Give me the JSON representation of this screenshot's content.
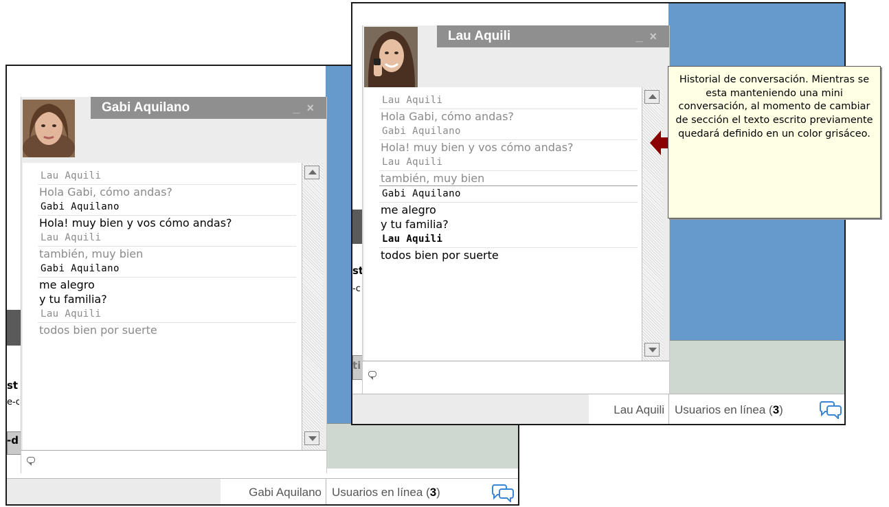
{
  "back_window": {
    "title": "Gabi Aquilano",
    "controls": {
      "minimize": "_",
      "close": "×"
    },
    "messages": [
      {
        "kind": "sender",
        "text": "Lau Aquili",
        "tone": "grey"
      },
      {
        "kind": "text",
        "text": "Hola Gabi, cómo andas?",
        "tone": "grey"
      },
      {
        "kind": "sender",
        "text": "Gabi Aquilano",
        "tone": "dark"
      },
      {
        "kind": "text",
        "text": "Hola! muy bien y vos cómo andas?",
        "tone": "dark"
      },
      {
        "kind": "sender",
        "text": "Lau Aquili",
        "tone": "grey"
      },
      {
        "kind": "text",
        "text": "también, muy bien",
        "tone": "grey"
      },
      {
        "kind": "sender",
        "text": "Gabi Aquilano",
        "tone": "dark"
      },
      {
        "kind": "text",
        "text": "me alegro",
        "tone": "dark"
      },
      {
        "kind": "text",
        "text": "y tu familia?",
        "tone": "dark"
      },
      {
        "kind": "sender",
        "text": "Lau Aquili",
        "tone": "grey"
      },
      {
        "kind": "text",
        "text": "todos bien por suerte",
        "tone": "grey"
      }
    ],
    "input_value": "",
    "tab_name": "Gabi Aquilano",
    "users_label": "Usuarios en línea (",
    "users_count": "3",
    "users_close": ")",
    "cutoff_text": {
      "a": "st",
      "b": "e-c",
      "c": "-d"
    }
  },
  "front_window": {
    "title": "Lau Aquili",
    "controls": {
      "minimize": "_",
      "close": "×"
    },
    "messages": [
      {
        "kind": "sender",
        "text": "Lau Aquili",
        "tone": "grey"
      },
      {
        "kind": "text",
        "text": "Hola Gabi, cómo andas?",
        "tone": "grey"
      },
      {
        "kind": "sender",
        "text": "Gabi Aquilano",
        "tone": "grey"
      },
      {
        "kind": "text",
        "text": "Hola! muy bien y vos cómo andas?",
        "tone": "grey"
      },
      {
        "kind": "sender",
        "text": "Lau Aquili",
        "tone": "grey"
      },
      {
        "kind": "text",
        "text": "también, muy bien",
        "tone": "grey"
      },
      {
        "kind": "sender",
        "text": "Gabi Aquilano",
        "tone": "dark"
      },
      {
        "kind": "text",
        "text": "me alegro",
        "tone": "dark"
      },
      {
        "kind": "text",
        "text": "y tu familia?",
        "tone": "dark"
      },
      {
        "kind": "sender",
        "text": "Lau Aquili",
        "tone": "dark-bold"
      },
      {
        "kind": "text",
        "text": "todos bien por suerte",
        "tone": "dark"
      }
    ],
    "input_value": "",
    "tab_name": "Lau Aquili",
    "users_label": "Usuarios en línea (",
    "users_count": "3",
    "users_close": ")",
    "cutoff_text": {
      "a": "st",
      "b": "-c",
      "c": "ti"
    }
  },
  "annotation": {
    "text": "Historial de conversación. Mientras se esta manteniendo una mini conversación, al momento de cambiar de sección el texto escrito previamente quedará definido en un color grisáceo."
  },
  "colors": {
    "title_bar": "#8f8f8f",
    "old_message": "#8a8a8a",
    "new_message": "#000000",
    "note_bg": "#ffffe3",
    "arrow": "#8b0000",
    "page_blue": "#6699cc"
  },
  "icons": [
    "avatar-photo",
    "chat-bubble-icon",
    "users-bubbles-icon",
    "scroll-up-icon",
    "scroll-down-icon",
    "arrow-left-icon"
  ]
}
